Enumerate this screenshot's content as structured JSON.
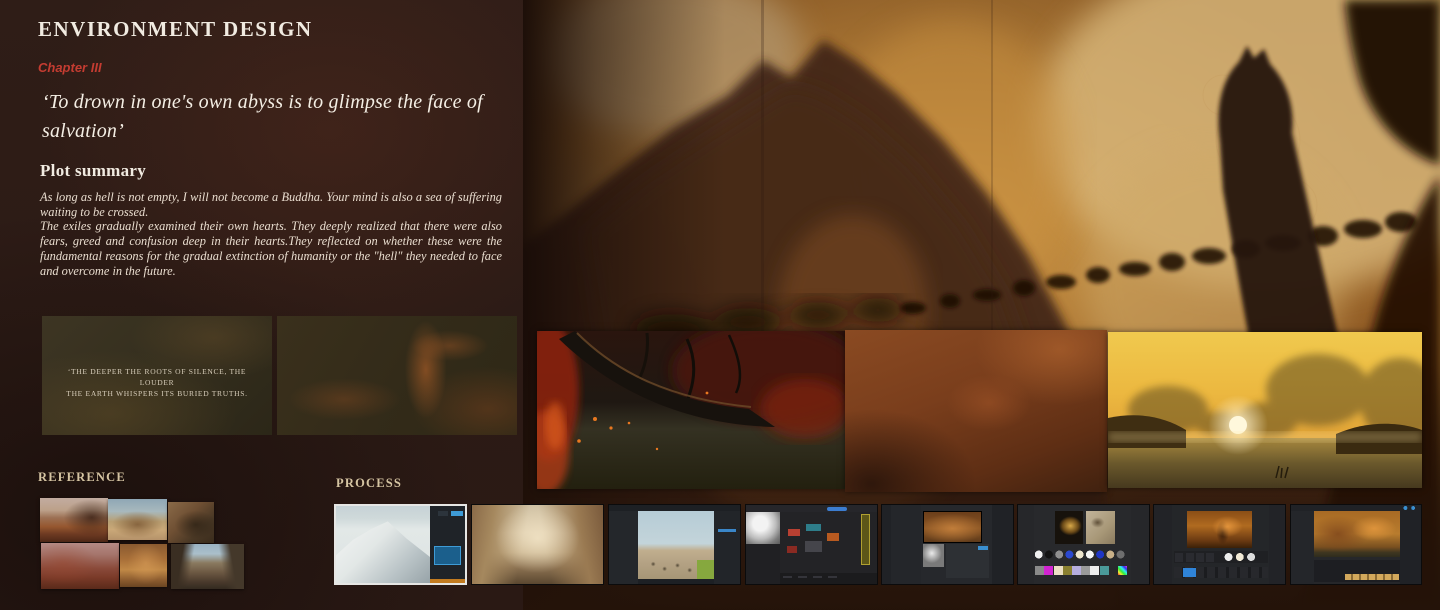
{
  "header": {
    "title": "ENVIRONMENT DESIGN",
    "chapter": "Chapter III"
  },
  "quote": {
    "text": "‘To drown in one's own abyss is to glimpse the face of salvation’"
  },
  "plot": {
    "heading": "Plot summary",
    "para1": "As long as hell is not empty, I will not become a Buddha. Your mind is also a sea of suffering waiting to be crossed.",
    "para2": "The exiles gradually examined their own hearts. They deeply realized that there were also fears, greed and confusion deep in their hearts.They reflected on whether these were the fundamental reasons for the gradual extinction of humanity or the \"hell\" they needed to face and overcome in the future."
  },
  "concepts": {
    "caption_line1": "‘The deeper the roots of silence, the louder",
    "caption_line2": "the earth whispers its buried truths."
  },
  "sections": {
    "reference_label": "REFERENCE",
    "process_label": "PROCESS"
  },
  "colors": {
    "chapter_red": "#c43c31",
    "title_white": "#f1ebe1",
    "label_cream": "#d5c4a2",
    "hero_amber": "#c28b3b",
    "sunset_gold": "#efc04a"
  }
}
